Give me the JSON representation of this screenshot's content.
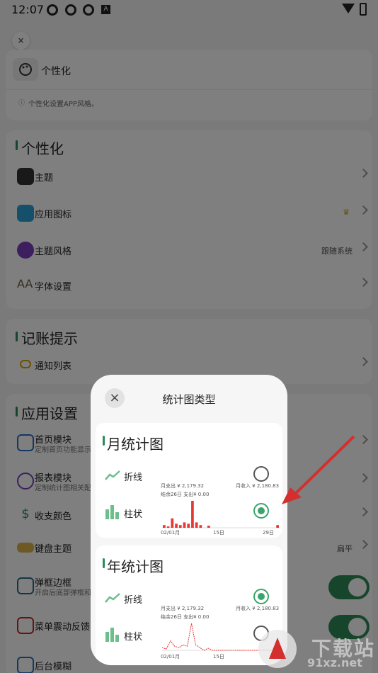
{
  "status": {
    "time": "12:07",
    "a_icon": "A"
  },
  "header": {
    "close_label": "×",
    "title": "个性化",
    "description": "个性化设置APP风格。"
  },
  "sections": {
    "personalize": {
      "title": "个性化",
      "items": [
        {
          "label": "主题"
        },
        {
          "label": "应用图标"
        },
        {
          "label": "主题风格",
          "value": "跟随系统"
        },
        {
          "label": "字体设置"
        }
      ]
    },
    "reminder": {
      "title": "记账提示",
      "items": [
        {
          "label": "通知列表"
        }
      ]
    },
    "app": {
      "title": "应用设置",
      "items": [
        {
          "label": "首页模块",
          "sub": "定制首页功能显示"
        },
        {
          "label": "报表模块",
          "sub": "定制统计图相关配"
        },
        {
          "label": "收支颜色"
        },
        {
          "label": "键盘主题",
          "value": "扁平"
        },
        {
          "label": "弹框边框",
          "sub": "开启后底部弹框和"
        },
        {
          "label": "菜单震动反馈"
        },
        {
          "label": "后台模糊"
        }
      ]
    }
  },
  "dialog": {
    "close_label": "×",
    "title": "统计图类型",
    "monthly": {
      "title": "月统计图",
      "line_label": "折线",
      "bar_label": "柱状",
      "expense_label": "月支出 ¥ 2,179.32",
      "income_label": "月收入 ¥ 2,180.83",
      "summary": "结余26日 支出¥ 0.00",
      "axis_start": "02/01月",
      "axis_mid": "15日",
      "axis_end": "29日",
      "selected": "bar"
    },
    "yearly": {
      "title": "年统计图",
      "line_label": "折线",
      "bar_label": "柱状",
      "expense_label": "月支出 ¥ 2,179.32",
      "income_label": "月收入 ¥ 2,180.83",
      "summary": "结余26日 支出¥ 0.00",
      "axis_start": "02/01月",
      "axis_mid": "15日",
      "selected": "line"
    }
  },
  "watermark": {
    "text": "下载站",
    "url": "91xz.net"
  },
  "colors": {
    "accent": "#2e8b57",
    "radio_on": "#3aa56b",
    "chart_red": "#e53935",
    "arrow": "#d32f2f"
  },
  "chart_data": [
    {
      "type": "bar",
      "categories": [
        "02/01月",
        "15日",
        "29日"
      ],
      "values": [
        0,
        2179.32,
        0
      ],
      "title": "月统计图",
      "xlabel": "",
      "ylabel": ""
    },
    {
      "type": "line",
      "categories": [
        "02/01月",
        "15日"
      ],
      "values": [
        0,
        2179.32
      ],
      "title": "年统计图",
      "xlabel": "",
      "ylabel": ""
    }
  ]
}
